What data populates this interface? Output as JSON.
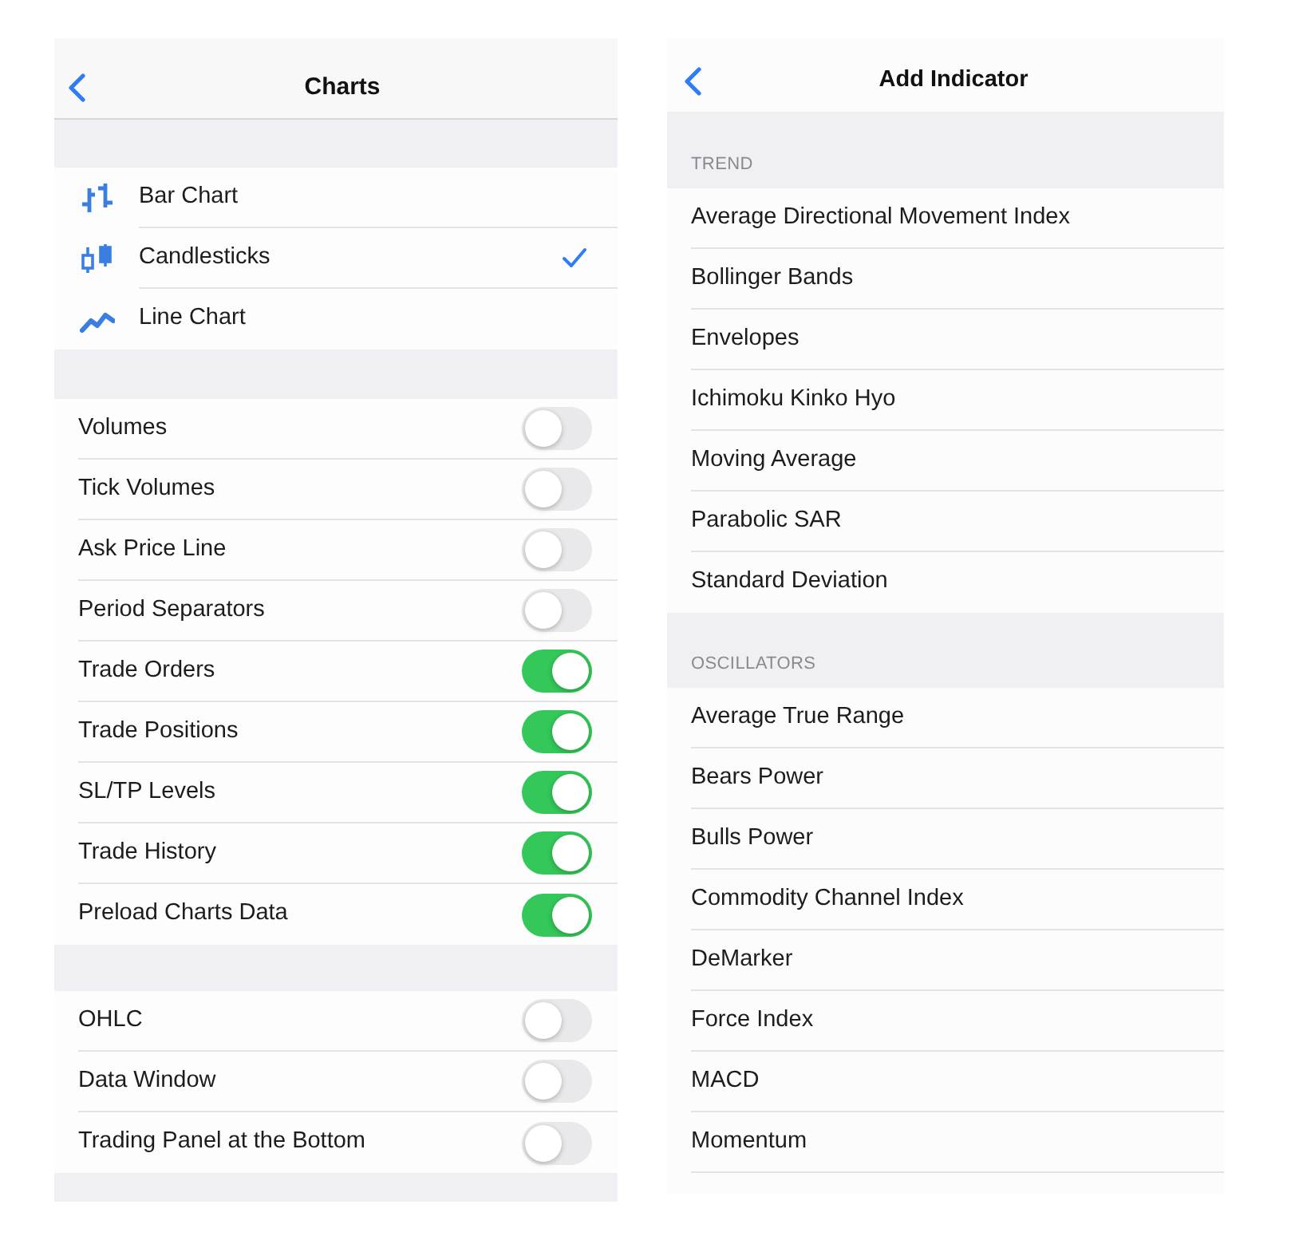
{
  "charts_screen": {
    "title": "Charts",
    "sections": [
      {
        "kind": "chart_types",
        "items": [
          {
            "label": "Bar Chart",
            "kind": "bars",
            "selected": false
          },
          {
            "label": "Candlesticks",
            "kind": "candles",
            "selected": true
          },
          {
            "label": "Line Chart",
            "kind": "line",
            "selected": false
          }
        ]
      },
      {
        "kind": "toggles",
        "items": [
          {
            "label": "Volumes",
            "on": false
          },
          {
            "label": "Tick Volumes",
            "on": false
          },
          {
            "label": "Ask Price Line",
            "on": false
          },
          {
            "label": "Period Separators",
            "on": false
          },
          {
            "label": "Trade Orders",
            "on": true
          },
          {
            "label": "Trade Positions",
            "on": true
          },
          {
            "label": "SL/TP Levels",
            "on": true
          },
          {
            "label": "Trade History",
            "on": true
          },
          {
            "label": "Preload Charts Data",
            "on": true
          }
        ]
      },
      {
        "kind": "toggles",
        "items": [
          {
            "label": "OHLC",
            "on": false
          },
          {
            "label": "Data Window",
            "on": false
          },
          {
            "label": "Trading Panel at the Bottom",
            "on": false
          }
        ]
      }
    ]
  },
  "add_indicator_screen": {
    "title": "Add Indicator",
    "groups": [
      {
        "header": "TREND",
        "items": [
          "Average Directional Movement Index",
          "Bollinger Bands",
          "Envelopes",
          "Ichimoku Kinko Hyo",
          "Moving Average",
          "Parabolic SAR",
          "Standard Deviation"
        ]
      },
      {
        "header": "OSCILLATORS",
        "items": [
          "Average True Range",
          "Bears Power",
          "Bulls Power",
          "Commodity Channel Index",
          "DeMarker",
          "Force Index",
          "MACD",
          "Momentum"
        ]
      }
    ]
  }
}
